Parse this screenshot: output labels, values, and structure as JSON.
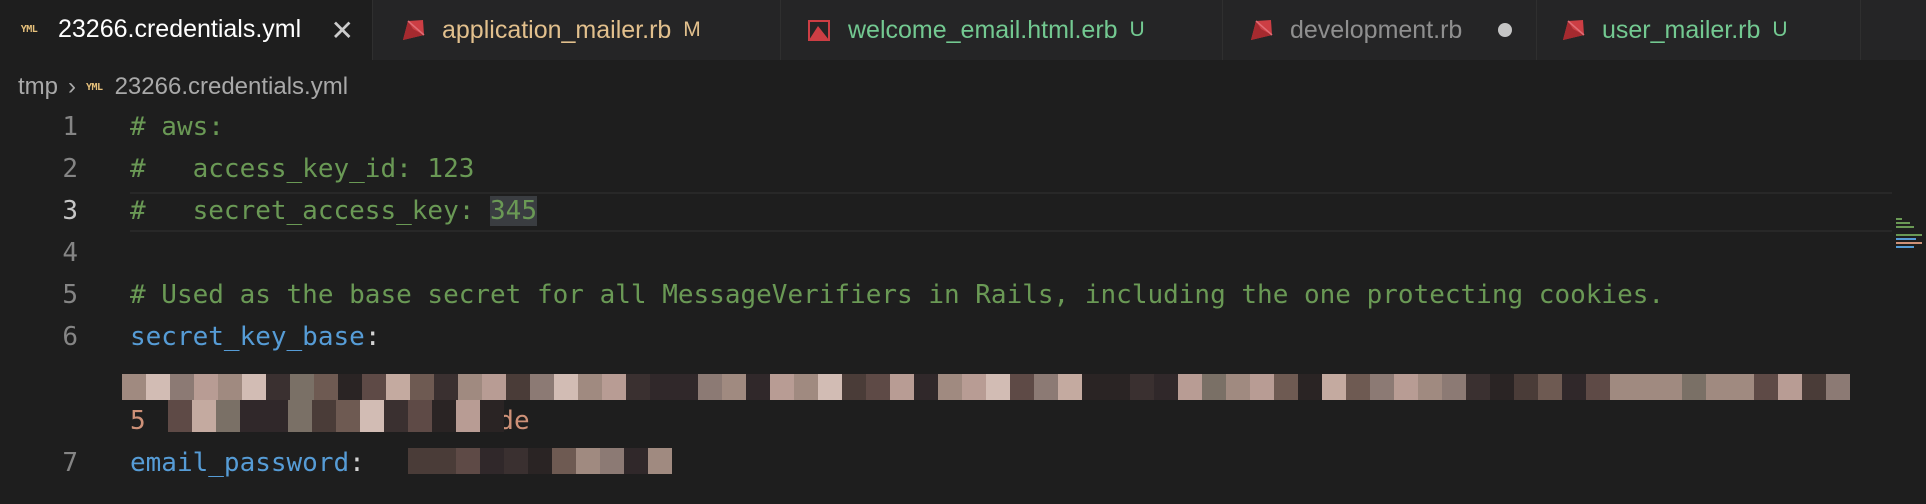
{
  "tabs": [
    {
      "icon": "yml-icon",
      "label": "23266.credentials.yml",
      "status": "",
      "active": true,
      "color": "#ffffff"
    },
    {
      "icon": "ruby-icon",
      "label": "application_mailer.rb",
      "status": "M",
      "active": false,
      "color": "#e2c08d"
    },
    {
      "icon": "erb-icon",
      "label": "welcome_email.html.erb",
      "status": "U",
      "active": false,
      "color": "#73c991"
    },
    {
      "icon": "ruby-icon",
      "label": "development.rb",
      "status": "",
      "active": false,
      "color": "#8f8f8f"
    },
    {
      "icon": "ruby-icon",
      "label": "user_mailer.rb",
      "status": "U",
      "active": false,
      "color": "#73c991"
    }
  ],
  "breadcrumb": {
    "folder": "tmp",
    "file": "23266.credentials.yml"
  },
  "editor": {
    "line_numbers": [
      "1",
      "2",
      "3",
      "4",
      "5",
      "6",
      "7"
    ],
    "current_line": 3,
    "lines": {
      "l1": "# aws:",
      "l2": "#   access_key_id: 123",
      "l3_prefix": "#   secret_access_key: ",
      "l3_selected": "345",
      "l5": "# Used as the base secret for all MessageVerifiers in Rails, including the one protecting cookies.",
      "l6_key": "secret_key_base",
      "l6_colon": ":",
      "l6_wrap_start": "5",
      "l6_wrap_end": "35de",
      "l7_key": "email_password",
      "l7_colon": ":"
    }
  },
  "colors": {
    "comment": "#6a9955",
    "key": "#569cd6",
    "string": "#ce9178",
    "ruby": "#cc3e44",
    "yml": "#e6c07b"
  }
}
